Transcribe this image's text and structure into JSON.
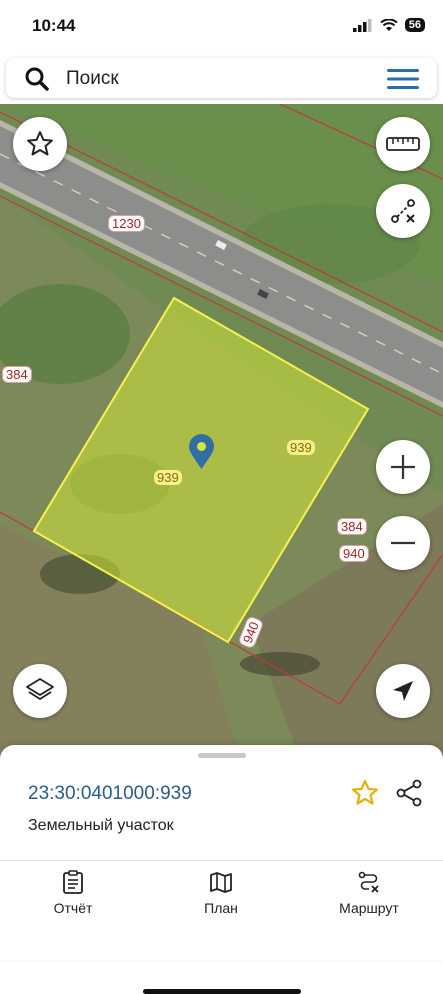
{
  "status": {
    "time": "10:44",
    "battery": "56"
  },
  "search": {
    "placeholder": "Поиск"
  },
  "map": {
    "parcel_labels": [
      "1230",
      "384",
      "939",
      "939",
      "384",
      "940",
      "940"
    ]
  },
  "parcel": {
    "cadastral_number": "23:30:0401000:939",
    "type": "Земельный участок"
  },
  "tabs": [
    {
      "label": "Отчёт"
    },
    {
      "label": "План"
    },
    {
      "label": "Маршрут"
    }
  ],
  "icons": [
    "search-icon",
    "menu-icon",
    "star-icon",
    "ruler-icon",
    "route-edit-icon",
    "plus-icon",
    "minus-icon",
    "layers-icon",
    "navigation-arrow-icon",
    "share-icon",
    "report-icon",
    "map-plan-icon",
    "route-icon"
  ],
  "colors": {
    "parcel_fill": "#d4e83a",
    "parcel_outline": "#f7f052",
    "boundary": "#c0393a",
    "accent_star": "#e6b012",
    "link": "#2a5c8a"
  }
}
